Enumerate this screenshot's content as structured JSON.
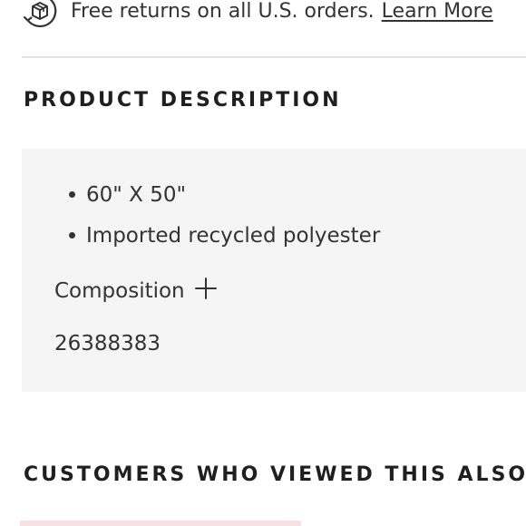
{
  "returns": {
    "text": "Free returns on all U.S. orders.",
    "link": "Learn More",
    "icon": "box-return-icon"
  },
  "product_description": {
    "heading": "PRODUCT DESCRIPTION",
    "bullets": [
      "60\" X 50\"",
      "Imported recycled polyester"
    ],
    "composition_label": "Composition",
    "composition_icon": "plus-icon",
    "sku": "26388383"
  },
  "customers": {
    "heading": "CUSTOMERS WHO VIEWED THIS ALSO VIEWED"
  },
  "colors": {
    "panel_background": "#f5f5f5",
    "divider": "#e4e4e4",
    "text": "#222222",
    "accent_strip": "#f7e1e4"
  }
}
